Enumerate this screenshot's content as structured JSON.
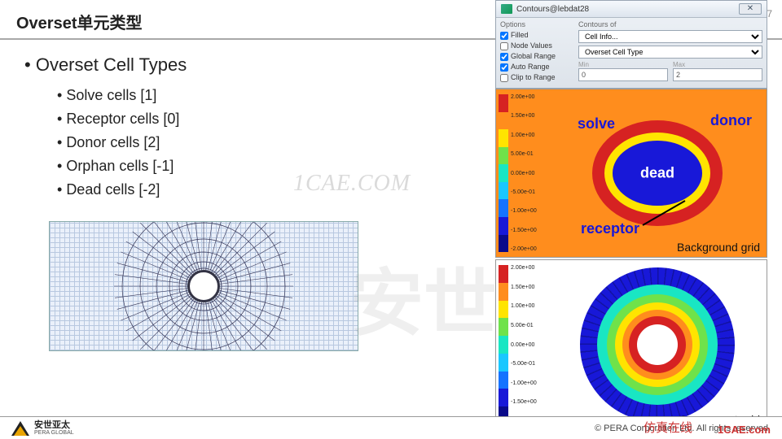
{
  "page_number": "7",
  "title": "Overset单元类型",
  "heading": "Overset Cell Types",
  "bullets": [
    "Solve cells  [1]",
    "Receptor cells  [0]",
    "Donor cells  [2]",
    "Orphan cells  [-1]",
    "Dead cells  [-2]"
  ],
  "dialog": {
    "title": "Contours@lebdat28",
    "options_label": "Options",
    "filled": "Filled",
    "node_values": "Node Values",
    "global_range": "Global Range",
    "auto_range": "Auto Range",
    "clip": "Clip to Range",
    "contours_of": "Contours of",
    "sel1": "Cell Info...",
    "sel2": "Overset Cell Type",
    "min_label": "Min",
    "max_label": "Max",
    "min_val": "0",
    "max_val": "2"
  },
  "legend_values": [
    "2.00e+00",
    "1.50e+00",
    "1.00e+00",
    "5.00e-01",
    "0.00e+00",
    "-5.00e-01",
    "-1.00e+00",
    "-1.50e+00",
    "-2.00e+00"
  ],
  "legend_colors": [
    "#d62222",
    "#ff8d1d",
    "#ffe400",
    "#6fe24a",
    "#19e6c3",
    "#1ac7ff",
    "#1573ff",
    "#1818d8",
    "#0a0a8a"
  ],
  "bg_labels": {
    "solve": "solve",
    "donor": "donor",
    "dead": "dead",
    "receptor": "receptor"
  },
  "caption_bg": "Background grid",
  "caption_comp": "Component grid",
  "footer": {
    "logo_cn": "安世亚太",
    "logo_en": "PERA GLOBAL",
    "copyright": "©   PERA Corporation Ltd. All rights reserved."
  },
  "watermark1": "1CAE.COM",
  "watermark2": "安世",
  "wm_footer1": "仿真在线",
  "wm_footer2": "1CAE.com"
}
